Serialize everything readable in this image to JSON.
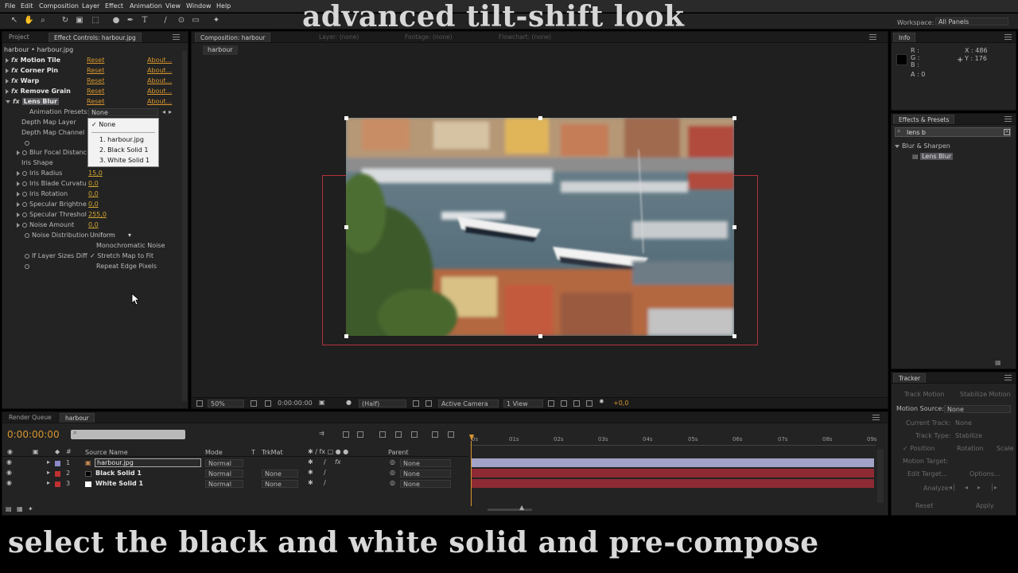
{
  "title_top": "advanced tilt-shift look",
  "caption_bottom": "select the black and white solid and pre-compose",
  "menu": [
    "File",
    "Edit",
    "Composition",
    "Layer",
    "Effect",
    "Animation",
    "View",
    "Window",
    "Help"
  ],
  "workspace": {
    "label": "Workspace:",
    "value": "All Panels"
  },
  "tools": [
    "arrow-icon",
    "hand-icon",
    "zoom-icon",
    "rotate-icon",
    "camera-icon",
    "pan-behind-icon",
    "mask-icon",
    "pen-icon",
    "text-icon",
    "brush-icon",
    "clone-icon",
    "eraser-icon",
    "roto-icon",
    "puppet-icon"
  ],
  "left_panel": {
    "tabs": [
      "Project",
      "Effect Controls: harbour.jpg"
    ],
    "breadcrumb": "harbour • harbour.jpg",
    "effects": [
      {
        "name": "Motion Tile",
        "reset": "Reset",
        "about": "About..."
      },
      {
        "name": "Corner Pin",
        "reset": "Reset",
        "about": "About..."
      },
      {
        "name": "Warp",
        "reset": "Reset",
        "about": "About..."
      },
      {
        "name": "Remove Grain",
        "reset": "Reset",
        "about": "About..."
      },
      {
        "name": "Lens Blur",
        "reset": "Reset",
        "about": "About..."
      }
    ],
    "animation_presets_label": "Animation Presets:",
    "animation_presets_value": "None",
    "props": [
      "Depth Map Layer",
      "Depth Map Channel",
      "Blur Focal Distanc",
      "Iris Shape",
      "Iris Radius",
      "Iris Blade Curvatu",
      "Iris Rotation",
      "Specular Brightne",
      "Specular Threshol",
      "Noise Amount",
      "Noise Distribution",
      "If Layer Sizes Diff"
    ],
    "values": {
      "iris_radius": "15,0",
      "iris_blade": "0,0",
      "iris_rotation": "0,0",
      "specular_brightness": "0,0",
      "specular_threshold": "255,0",
      "noise_amount": "0,0",
      "noise_distribution": "Uniform",
      "monochromatic": "Monochromatic Noise",
      "stretch_map": "Stretch Map to Fit",
      "repeat_edge": "Repeat Edge Pixels"
    },
    "dropdown": {
      "selected": "None",
      "options": [
        "1. harbour.jpg",
        "2. Black Solid 1",
        "3. White Solid 1"
      ]
    }
  },
  "comp_panel": {
    "tabs": [
      "Composition: harbour",
      "Layer: (none)",
      "Footage: (none)",
      "Flowchart: (none)"
    ],
    "sub_tab": "harbour",
    "zoom": "50%",
    "timecode": "0:00:00:00",
    "resolution": "(Half)",
    "camera": "Active Camera",
    "view": "1 View",
    "exposure": "+0,0"
  },
  "info_panel": {
    "tab": "Info",
    "r": "R :",
    "g": "G :",
    "b": "B :",
    "a": "A : 0",
    "x": "X : 486",
    "y": "Y : 176"
  },
  "effects_presets": {
    "tab": "Effects & Presets",
    "search": "lens b",
    "category": "Blur & Sharpen",
    "item": "Lens Blur"
  },
  "tracker": {
    "tab": "Tracker",
    "track_motion": "Track Motion",
    "stabilize_motion": "Stabilize Motion",
    "motion_source_label": "Motion Source:",
    "motion_source_value": "None",
    "current_track_label": "Current Track:",
    "current_track_value": "None",
    "track_type_label": "Track Type:",
    "track_type_value": "Stabilize",
    "position": "Position",
    "rotation": "Rotation",
    "scale": "Scale",
    "motion_target": "Motion Target:",
    "edit_target": "Edit Target...",
    "options": "Options...",
    "analyze": "Analyze:",
    "reset": "Reset",
    "apply": "Apply"
  },
  "timeline": {
    "tabs": [
      "Render Queue",
      "harbour"
    ],
    "timecode": "0:00:00:00",
    "columns": {
      "source_name": "Source Name",
      "mode": "Mode",
      "t": "T",
      "trkmat": "TrkMat",
      "parent": "Parent"
    },
    "layers": [
      {
        "num": "1",
        "name": "harbour.jpg",
        "mode": "Normal",
        "trkmat": "",
        "parent": "None",
        "color": "#8a8ac8"
      },
      {
        "num": "2",
        "name": "Black Solid 1",
        "mode": "Normal",
        "trkmat": "None",
        "parent": "None",
        "color": "#c03030"
      },
      {
        "num": "3",
        "name": "White Solid 1",
        "mode": "Normal",
        "trkmat": "None",
        "parent": "None",
        "color": "#c03030"
      }
    ],
    "ruler": [
      "0s",
      "01s",
      "02s",
      "03s",
      "04s",
      "05s",
      "06s",
      "07s",
      "08s",
      "09s"
    ]
  },
  "colors": {
    "accent_orange": "#d7962e",
    "layer1_bar": "#a3a3c8",
    "solid_bar": "#8e2a33",
    "outline_red": "#b3323c"
  }
}
